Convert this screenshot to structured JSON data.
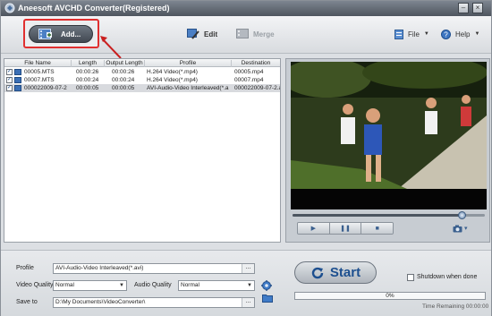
{
  "window": {
    "title": "Aneesoft AVCHD Converter(Registered)"
  },
  "toolbar": {
    "add_label": "Add...",
    "edit_label": "Edit",
    "merge_label": "Merge",
    "file_label": "File",
    "help_label": "Help"
  },
  "file_list": {
    "columns": [
      "File Name",
      "Length",
      "Output Length",
      "Profile",
      "Destination"
    ],
    "rows": [
      {
        "checked": true,
        "name": "00005.MTS",
        "length": "00:00:26",
        "output_length": "00:00:26",
        "profile": "H.264 Video(*.mp4)",
        "destination": "00005.mp4"
      },
      {
        "checked": true,
        "name": "00007.MTS",
        "length": "00:00:24",
        "output_length": "00:00:24",
        "profile": "H.264 Video(*.mp4)",
        "destination": "00007.mp4"
      },
      {
        "checked": true,
        "name": "000022009-07-2",
        "length": "00:00:05",
        "output_length": "00:00:05",
        "profile": "AVI-Audio-Video Interleaved(*.a",
        "destination": "000022009-07-2.a"
      }
    ]
  },
  "preview": {
    "seek_fraction": 0.88
  },
  "settings": {
    "profile_label": "Profile",
    "profile_value": "AVI-Audio-Video Interleaved(*.avi)",
    "video_quality_label": "Video Quality",
    "video_quality_value": "Normal",
    "audio_quality_label": "Audio Quality",
    "audio_quality_value": "Normal",
    "save_to_label": "Save to",
    "save_to_value": "D:\\My Documents\\VideoConverter\\",
    "browse_label": "..."
  },
  "conversion": {
    "start_label": "Start",
    "shutdown_label": "Shutdown when done",
    "shutdown_checked": false,
    "progress_percent": 0,
    "progress_text": "0%",
    "time_remaining": "Time Remaining 00:00:00"
  },
  "colors": {
    "accent": "#1d4f8f",
    "highlight": "#e03030"
  }
}
